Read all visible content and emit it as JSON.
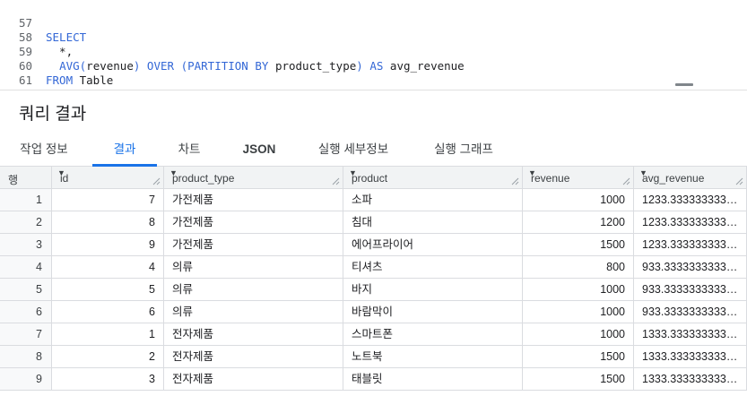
{
  "editor": {
    "lines": [
      {
        "num": "57",
        "text": "SELECT"
      },
      {
        "num": "58",
        "text": "  *,"
      },
      {
        "num": "59",
        "text": "  AVG(revenue) OVER (PARTITION BY product_type) AS avg_revenue"
      },
      {
        "num": "60",
        "text": "FROM Table"
      },
      {
        "num": "61",
        "text": ""
      }
    ]
  },
  "results": {
    "title": "쿼리 결과",
    "tabs": [
      {
        "label": "작업 정보"
      },
      {
        "label": "결과"
      },
      {
        "label": "차트"
      },
      {
        "label": "JSON"
      },
      {
        "label": "실행 세부정보"
      },
      {
        "label": "실행 그래프"
      }
    ],
    "active_tab": "결과",
    "columns": [
      {
        "label": "행"
      },
      {
        "label": "id"
      },
      {
        "label": "product_type"
      },
      {
        "label": "product"
      },
      {
        "label": "revenue"
      },
      {
        "label": "avg_revenue"
      }
    ],
    "rows": [
      {
        "row": "1",
        "id": "7",
        "product_type": "가전제품",
        "product": "소파",
        "revenue": "1000",
        "avg_revenue": "1233.3333333333..."
      },
      {
        "row": "2",
        "id": "8",
        "product_type": "가전제품",
        "product": "침대",
        "revenue": "1200",
        "avg_revenue": "1233.3333333333..."
      },
      {
        "row": "3",
        "id": "9",
        "product_type": "가전제품",
        "product": "에어프라이어",
        "revenue": "1500",
        "avg_revenue": "1233.3333333333..."
      },
      {
        "row": "4",
        "id": "4",
        "product_type": "의류",
        "product": "티셔츠",
        "revenue": "800",
        "avg_revenue": "933.33333333333..."
      },
      {
        "row": "5",
        "id": "5",
        "product_type": "의류",
        "product": "바지",
        "revenue": "1000",
        "avg_revenue": "933.33333333333..."
      },
      {
        "row": "6",
        "id": "6",
        "product_type": "의류",
        "product": "바람막이",
        "revenue": "1000",
        "avg_revenue": "933.33333333333..."
      },
      {
        "row": "7",
        "id": "1",
        "product_type": "전자제품",
        "product": "스마트폰",
        "revenue": "1000",
        "avg_revenue": "1333.3333333333..."
      },
      {
        "row": "8",
        "id": "2",
        "product_type": "전자제품",
        "product": "노트북",
        "revenue": "1500",
        "avg_revenue": "1333.3333333333..."
      },
      {
        "row": "9",
        "id": "3",
        "product_type": "전자제품",
        "product": "태블릿",
        "revenue": "1500",
        "avg_revenue": "1333.3333333333..."
      }
    ]
  },
  "colors": {
    "accent": "#1a73e8",
    "keyword": "#3367d6",
    "header_bg": "#f1f3f4",
    "border": "#dadce0"
  },
  "icons": {
    "sort": "caret-down-icon",
    "column_resize": "resize-grip-icon",
    "editor_resize": "drag-handle-icon"
  }
}
